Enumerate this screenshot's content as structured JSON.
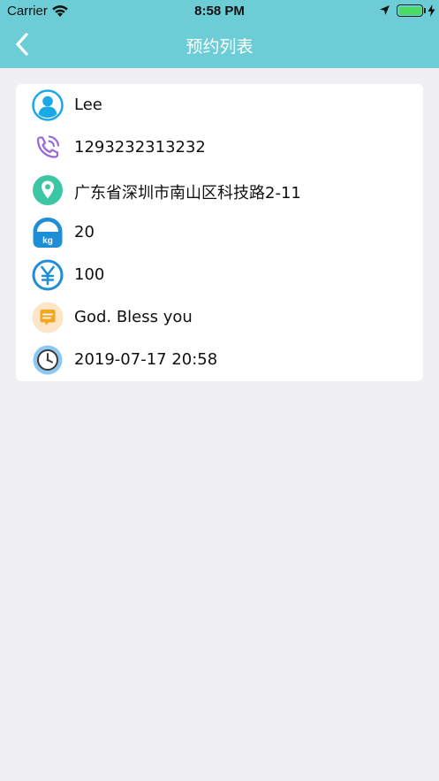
{
  "status_bar": {
    "carrier": "Carrier",
    "time": "8:58 PM"
  },
  "nav": {
    "title": "预约列表",
    "back_icon": "chevron-left-icon"
  },
  "colors": {
    "header": "#6dcdd7",
    "background": "#efeff4",
    "battery": "#4cd964"
  },
  "details": {
    "name": "Lee",
    "phone": "1293232313232",
    "address": "广东省深圳市南山区科技路2-11",
    "weight": "20",
    "weight_icon_label": "kg",
    "price": "100",
    "message": "God. Bless you",
    "datetime": "2019-07-17 20:58"
  },
  "icons": [
    "user-icon",
    "phone-icon",
    "location-icon",
    "weight-icon",
    "yen-icon",
    "message-icon",
    "clock-icon"
  ]
}
